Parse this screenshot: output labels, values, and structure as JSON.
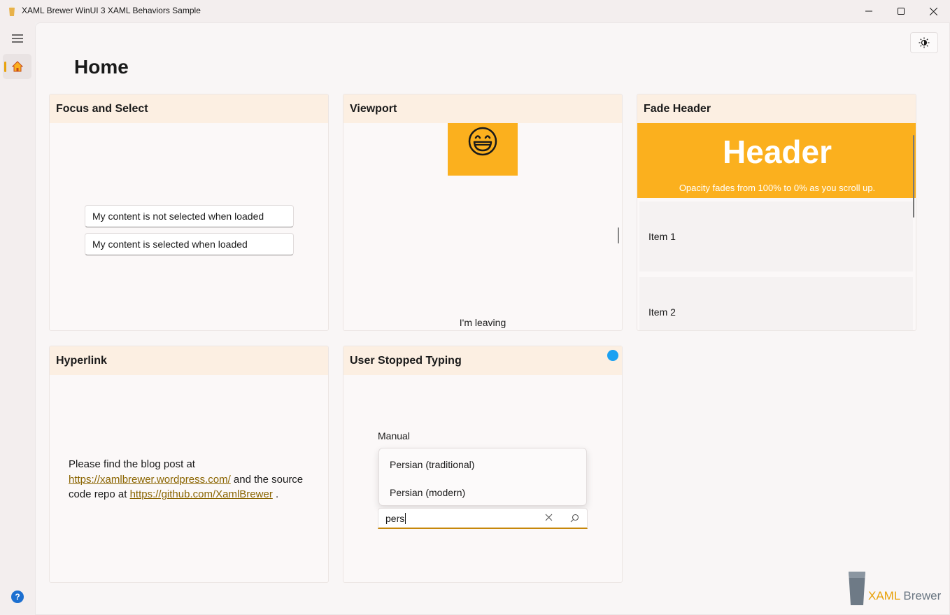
{
  "window": {
    "title": "XAML Brewer WinUI 3 XAML Behaviors Sample"
  },
  "nav": {
    "items": [
      {
        "name": "home",
        "icon": "home-icon",
        "selected": true
      }
    ],
    "help_label": "?"
  },
  "page": {
    "title": "Home"
  },
  "cards": {
    "focus_select": {
      "title": "Focus and Select",
      "textbox1_value": "My content is not selected when loaded",
      "textbox2_value": "My content is selected when loaded"
    },
    "viewport": {
      "title": "Viewport",
      "emoji": "😄",
      "caption": "I'm leaving"
    },
    "fade_header": {
      "title": "Fade Header",
      "header_text": "Header",
      "header_subtext": "Opacity fades from 100% to 0% as you scroll up.",
      "items": [
        "Item 1",
        "Item 2"
      ]
    },
    "hyperlink": {
      "title": "Hyperlink",
      "text_before": "Please find the blog post at ",
      "link1": "https://xamlbrewer.wordpress.com/",
      "text_middle": " and the source code repo at ",
      "link2": "https://github.com/XamlBrewer",
      "text_after": " ."
    },
    "user_stopped_typing": {
      "title": "User Stopped Typing",
      "label": "Manual",
      "suggestions": [
        "Persian (traditional)",
        "Persian (modern)"
      ],
      "search_value": "pers"
    }
  },
  "logo": {
    "part1": "XAML",
    "part2": " Brewer"
  },
  "colors": {
    "accent": "#fbb01e",
    "link": "#8a6400",
    "card_header": "#fcefe2",
    "indicator": "#e8a20c",
    "busy_dot": "#1ba1f2"
  }
}
